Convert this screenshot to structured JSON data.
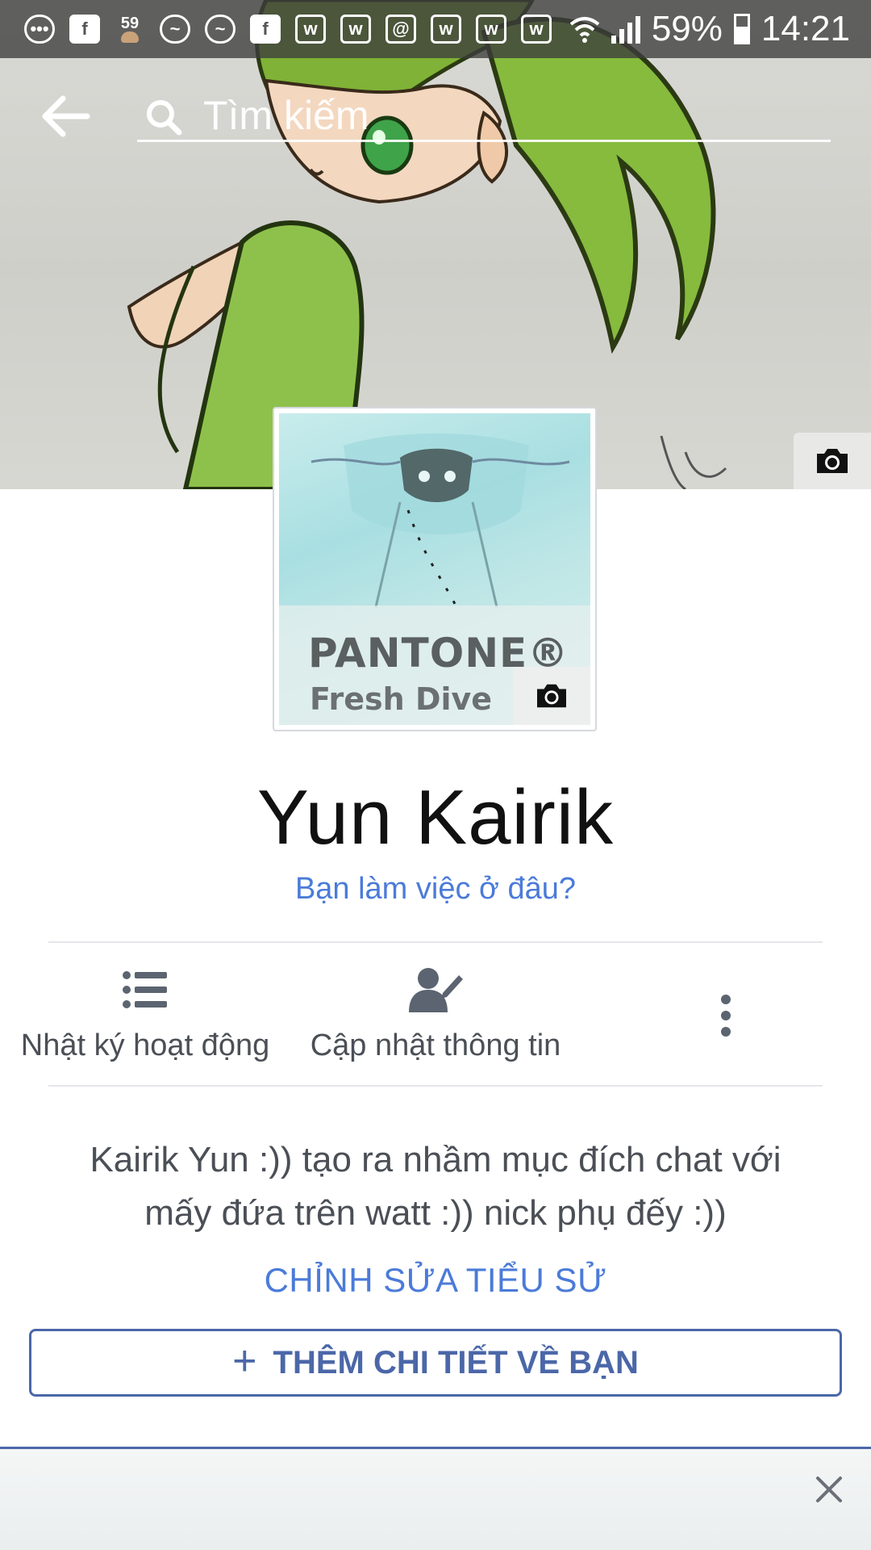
{
  "status_bar": {
    "battery": "59%",
    "time": "14:21",
    "badge": "59",
    "icons": [
      "messenger-bubble-icon",
      "facebook-icon",
      "avatar-notification-icon",
      "messenger-icon",
      "messenger-icon",
      "facebook-icon",
      "wattpad-icon",
      "wattpad-icon",
      "email-icon",
      "wattpad-icon",
      "wattpad-icon",
      "wattpad-icon",
      "wifi-icon",
      "signal-icon",
      "battery-icon"
    ]
  },
  "search": {
    "placeholder": "Tìm kiếm"
  },
  "profile": {
    "name": "Yun Kairik",
    "work_prompt": "Bạn làm việc ở đâu?",
    "avatar": {
      "brand": "PANTONE®",
      "color_name": "Fresh Dive"
    }
  },
  "actions": [
    {
      "label": "Nhật ký hoạt động",
      "icon": "list-icon"
    },
    {
      "label": "Cập nhật thông tin",
      "icon": "edit-profile-icon"
    },
    {
      "label": "",
      "icon": "more-vertical-icon"
    }
  ],
  "bio": {
    "text": "Kairik Yun :)) tạo ra nhầm mục đích chat với mấy đứa trên watt :)) nick phụ đếy :))",
    "edit_label": "CHỈNH SỬA TIỂU SỬ"
  },
  "add_details": {
    "label": "THÊM CHI TIẾT VỀ BẠN",
    "icon": "plus-icon"
  },
  "colors": {
    "link": "#4b7bd9",
    "accent": "#4b67a8",
    "text_secondary": "#4b4f56"
  }
}
